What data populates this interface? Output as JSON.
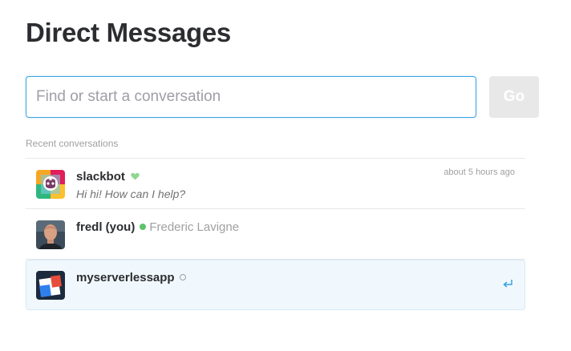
{
  "page": {
    "title": "Direct Messages"
  },
  "search": {
    "placeholder": "Find or start a conversation",
    "value": "",
    "go_label": "Go"
  },
  "recent_label": "Recent conversations",
  "conversations": [
    {
      "name": "slackbot",
      "subtitle": "Hi hi! How can I help?",
      "timestamp": "about 5 hours ago",
      "badge_icon": "heart-icon",
      "avatar": "slackbot-avatar"
    },
    {
      "name": "fredl (you)",
      "real_name": "Frederic Lavigne",
      "presence": "active",
      "avatar": "user-photo-avatar"
    },
    {
      "name": "myserverlessapp",
      "presence": "away",
      "avatar": "app-avatar",
      "selected": true,
      "action_icon": "enter-icon"
    }
  ],
  "colors": {
    "accent": "#3aa3e3",
    "presence_active": "#5ec26b",
    "heart": "#8fd68f",
    "selected_background": "#f0f8fd"
  }
}
